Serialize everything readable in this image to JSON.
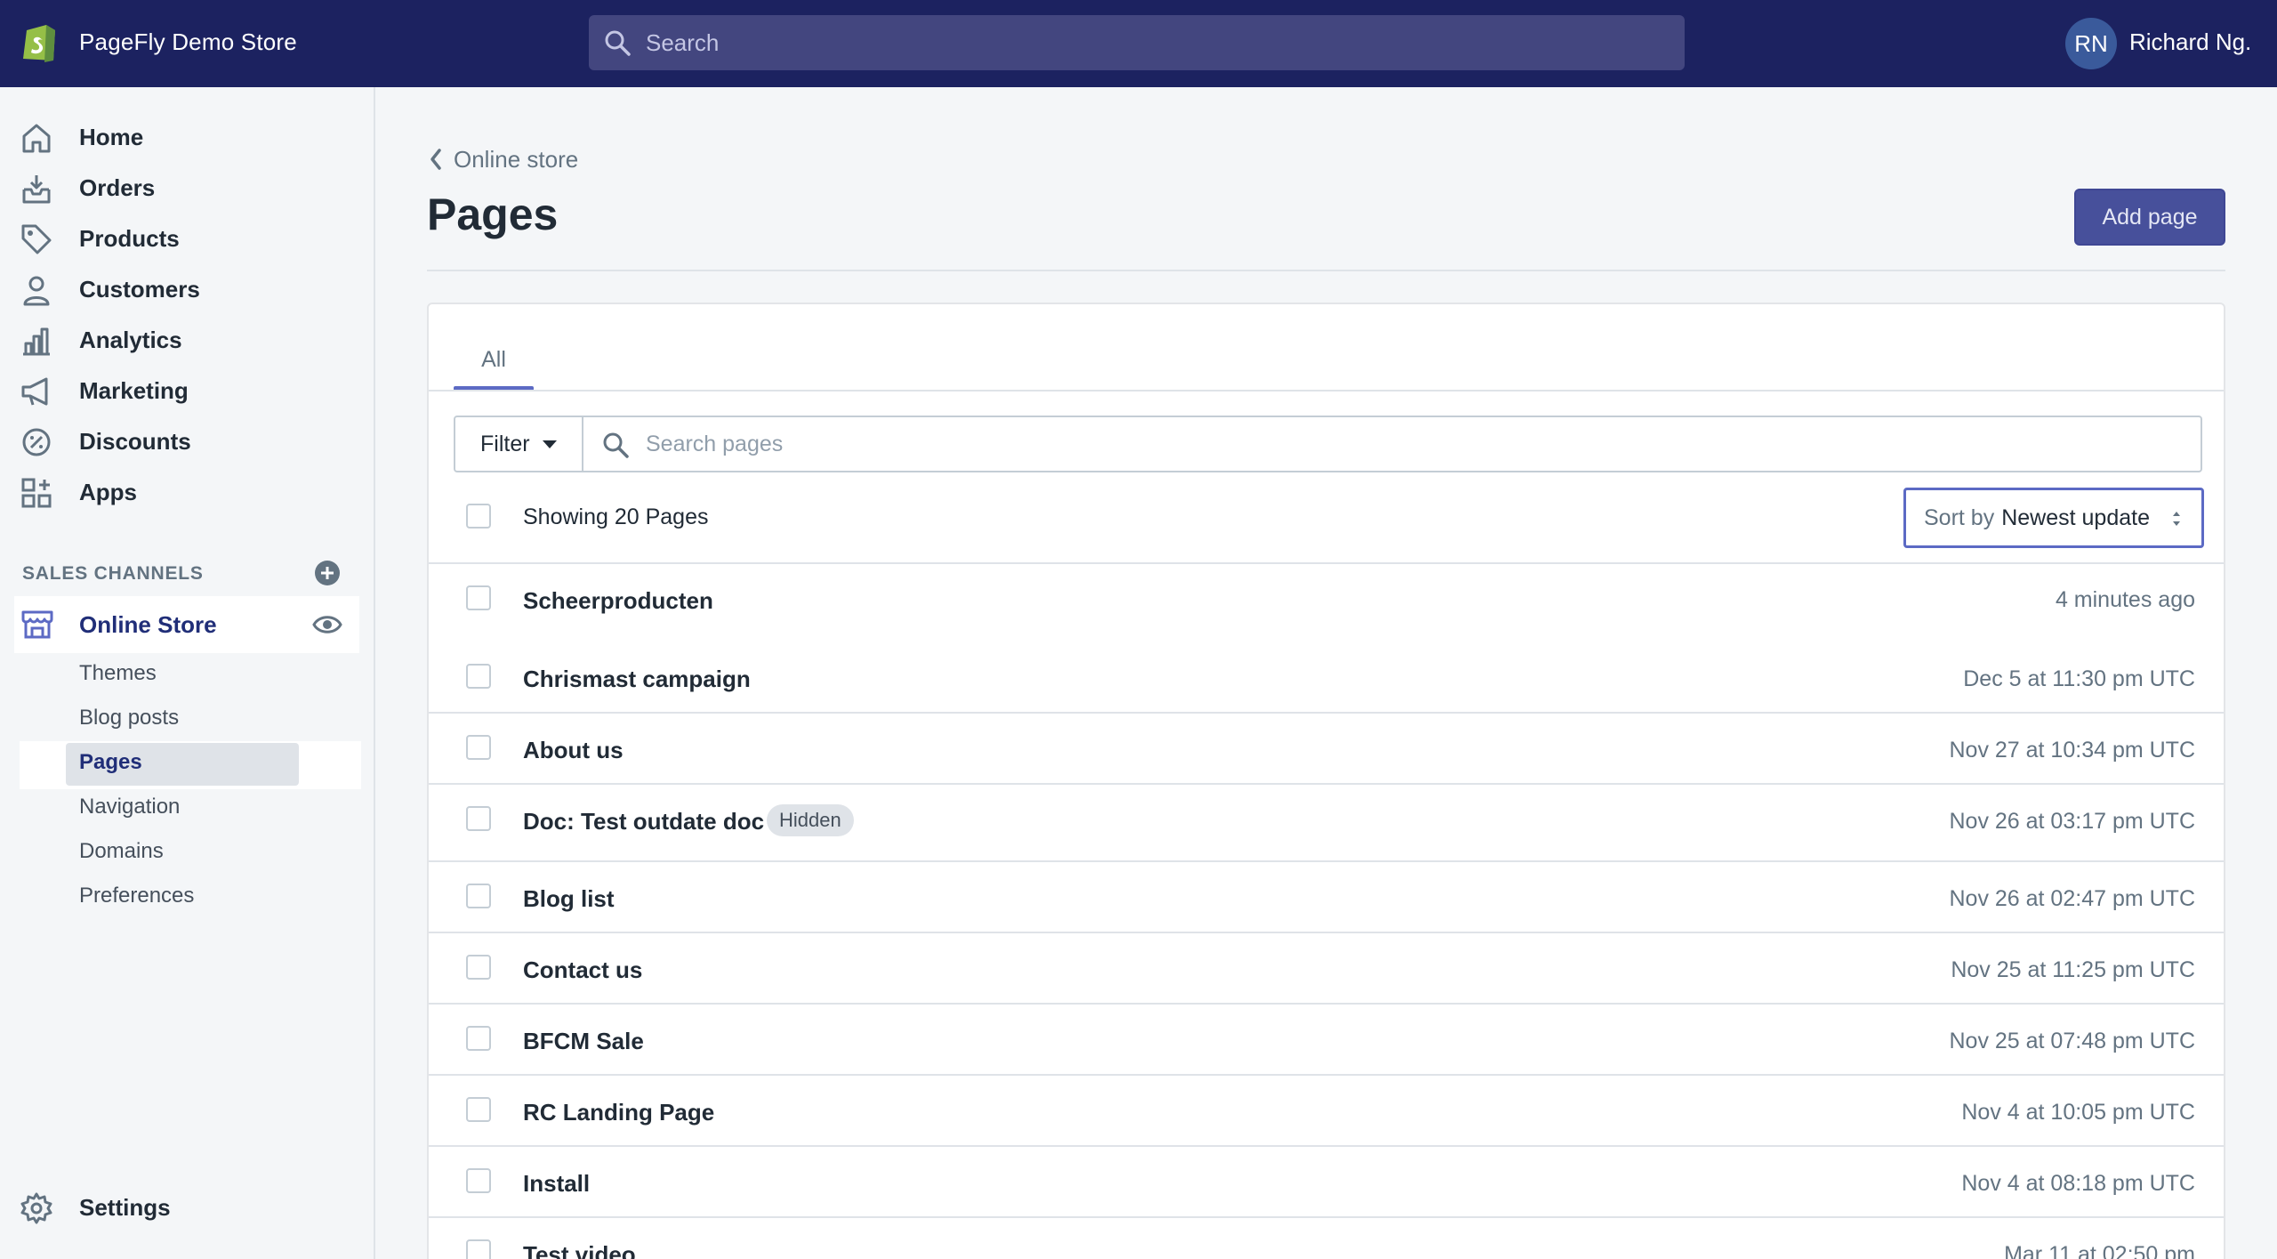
{
  "topbar": {
    "store_name": "PageFly Demo Store",
    "search_placeholder": "Search",
    "avatar_initials": "RN",
    "user_name": "Richard Ng."
  },
  "sidebar": {
    "items": [
      {
        "label": "Home",
        "icon": "home-icon"
      },
      {
        "label": "Orders",
        "icon": "orders-icon"
      },
      {
        "label": "Products",
        "icon": "tag-icon"
      },
      {
        "label": "Customers",
        "icon": "person-icon"
      },
      {
        "label": "Analytics",
        "icon": "bar-chart-icon"
      },
      {
        "label": "Marketing",
        "icon": "megaphone-icon"
      },
      {
        "label": "Discounts",
        "icon": "discount-icon"
      },
      {
        "label": "Apps",
        "icon": "apps-icon"
      }
    ],
    "sales_channels_title": "SALES CHANNELS",
    "online_store_label": "Online Store",
    "sub_items": [
      "Themes",
      "Blog posts",
      "Pages",
      "Navigation",
      "Domains",
      "Preferences"
    ],
    "settings_label": "Settings"
  },
  "main": {
    "breadcrumb": "Online store",
    "title": "Pages",
    "add_button": "Add page",
    "tab_all": "All",
    "filter_label": "Filter",
    "search_placeholder": "Search pages",
    "showing_text": "Showing 20 Pages",
    "sort_prefix": "Sort by",
    "sort_value": "Newest update",
    "rows": [
      {
        "name": "Scheerproducten",
        "date": "4 minutes ago",
        "badge": ""
      },
      {
        "name": "Chrismast campaign",
        "date": "Dec 5 at 11:30 pm UTC",
        "badge": ""
      },
      {
        "name": "About us",
        "date": "Nov 27 at 10:34 pm UTC",
        "badge": ""
      },
      {
        "name": "Doc: Test outdate doc",
        "date": "Nov 26 at 03:17 pm UTC",
        "badge": "Hidden"
      },
      {
        "name": "Blog list",
        "date": "Nov 26 at 02:47 pm UTC",
        "badge": ""
      },
      {
        "name": "Contact us",
        "date": "Nov 25 at 11:25 pm UTC",
        "badge": ""
      },
      {
        "name": "BFCM Sale",
        "date": "Nov 25 at 07:48 pm UTC",
        "badge": ""
      },
      {
        "name": "RC Landing Page",
        "date": "Nov 4 at 10:05 pm UTC",
        "badge": ""
      },
      {
        "name": "Install",
        "date": "Nov 4 at 08:18 pm UTC",
        "badge": ""
      },
      {
        "name": "Test video",
        "date": "Mar 11 at 02:50 pm",
        "badge": ""
      }
    ]
  },
  "colors": {
    "topbar": "#1c2260",
    "accent": "#5c6ac4",
    "primary_button": "#47509b"
  }
}
